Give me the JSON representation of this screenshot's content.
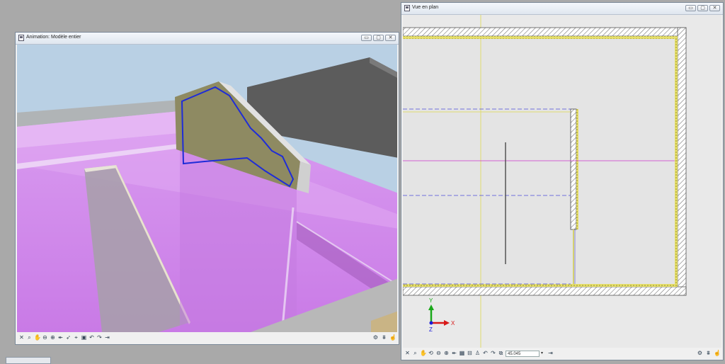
{
  "windows": {
    "animation": {
      "title": "Animation: Modèle entier",
      "buttons": [
        "▭",
        "▢",
        "✕"
      ]
    },
    "plan": {
      "title": "Vue en plan",
      "buttons": [
        "▭",
        "▢",
        "✕"
      ],
      "zoom_value": "45.045",
      "axis_labels": {
        "y": "Y",
        "x": "X",
        "z": "Z"
      }
    }
  },
  "colors": {
    "magenta_wall": "#d07ae8",
    "wall_gray": "#9aa0a0",
    "sky": "#b9d0e4",
    "dark_wall": "#5c5c5c",
    "hatch": "#888888",
    "insulation": "#e6df6a",
    "dashed_line": "#4a4ad8",
    "magenta_line": "#cc33cc"
  }
}
